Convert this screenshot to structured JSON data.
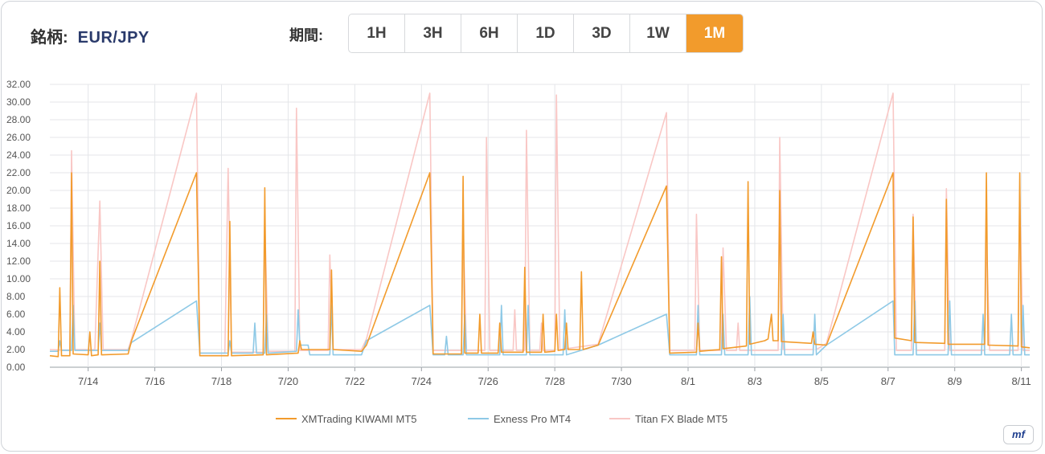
{
  "header": {
    "symbol_label": "銘柄:",
    "symbol_value": "EUR/JPY",
    "period_label": "期間:",
    "periods": [
      "1H",
      "3H",
      "6H",
      "1D",
      "3D",
      "1W",
      "1M"
    ],
    "active_period": "1M"
  },
  "logo_text": "mf",
  "chart_data": {
    "type": "line",
    "title": "",
    "xlabel": "",
    "ylabel": "",
    "ylim": [
      0,
      32
    ],
    "yticks": [
      "0.00",
      "2.00",
      "4.00",
      "6.00",
      "8.00",
      "10.00",
      "12.00",
      "14.00",
      "16.00",
      "18.00",
      "20.00",
      "22.00",
      "24.00",
      "26.00",
      "28.00",
      "30.00",
      "32.00"
    ],
    "xlim": [
      12.85,
      42.25
    ],
    "xticks": [
      {
        "value": 14,
        "label": "7/14"
      },
      {
        "value": 16,
        "label": "7/16"
      },
      {
        "value": 18,
        "label": "7/18"
      },
      {
        "value": 20,
        "label": "7/20"
      },
      {
        "value": 22,
        "label": "7/22"
      },
      {
        "value": 24,
        "label": "7/24"
      },
      {
        "value": 26,
        "label": "7/26"
      },
      {
        "value": 28,
        "label": "7/28"
      },
      {
        "value": 30,
        "label": "7/30"
      },
      {
        "value": 32,
        "label": "8/1"
      },
      {
        "value": 34,
        "label": "8/3"
      },
      {
        "value": 36,
        "label": "8/5"
      },
      {
        "value": 38,
        "label": "8/7"
      },
      {
        "value": 40,
        "label": "8/9"
      },
      {
        "value": 42,
        "label": "8/11"
      }
    ],
    "grid": true,
    "legend_position": "bottom-center",
    "series": [
      {
        "name": "XMTrading KIWAMI MT5",
        "color": "#f29b2c",
        "points": [
          [
            12.85,
            1.3
          ],
          [
            13.1,
            1.2
          ],
          [
            13.15,
            9.0
          ],
          [
            13.2,
            1.3
          ],
          [
            13.45,
            1.3
          ],
          [
            13.5,
            22.0
          ],
          [
            13.55,
            1.5
          ],
          [
            14.0,
            1.4
          ],
          [
            14.05,
            4.0
          ],
          [
            14.1,
            1.3
          ],
          [
            14.3,
            1.4
          ],
          [
            14.35,
            12.0
          ],
          [
            14.4,
            1.4
          ],
          [
            15.2,
            1.5
          ],
          [
            15.3,
            3.0
          ],
          [
            17.25,
            22.0
          ],
          [
            17.35,
            1.3
          ],
          [
            18.2,
            1.3
          ],
          [
            18.25,
            16.5
          ],
          [
            18.3,
            1.3
          ],
          [
            19.25,
            1.4
          ],
          [
            19.3,
            20.3
          ],
          [
            19.35,
            1.4
          ],
          [
            20.3,
            1.6
          ],
          [
            20.35,
            3.0
          ],
          [
            20.4,
            2.0
          ],
          [
            21.25,
            2.0
          ],
          [
            21.3,
            11.0
          ],
          [
            21.35,
            2.0
          ],
          [
            22.2,
            1.8
          ],
          [
            22.35,
            2.5
          ],
          [
            24.25,
            22.0
          ],
          [
            24.35,
            1.5
          ],
          [
            25.2,
            1.5
          ],
          [
            25.25,
            21.6
          ],
          [
            25.3,
            1.6
          ],
          [
            25.7,
            1.6
          ],
          [
            25.75,
            6.0
          ],
          [
            25.8,
            1.6
          ],
          [
            26.3,
            1.6
          ],
          [
            26.35,
            5.0
          ],
          [
            26.4,
            1.7
          ],
          [
            27.05,
            1.7
          ],
          [
            27.1,
            11.3
          ],
          [
            27.15,
            1.7
          ],
          [
            27.6,
            1.7
          ],
          [
            27.65,
            6.0
          ],
          [
            27.7,
            1.7
          ],
          [
            28.0,
            1.8
          ],
          [
            28.05,
            6.0
          ],
          [
            28.1,
            1.9
          ],
          [
            28.3,
            2.0
          ],
          [
            28.35,
            5.0
          ],
          [
            28.4,
            2.0
          ],
          [
            28.75,
            2.0
          ],
          [
            28.8,
            10.8
          ],
          [
            28.85,
            2.0
          ],
          [
            29.3,
            2.5
          ],
          [
            31.35,
            20.5
          ],
          [
            31.45,
            1.6
          ],
          [
            32.25,
            1.7
          ],
          [
            32.3,
            5.0
          ],
          [
            32.35,
            1.8
          ],
          [
            32.95,
            2.0
          ],
          [
            33.0,
            12.5
          ],
          [
            33.05,
            2.1
          ],
          [
            33.75,
            2.4
          ],
          [
            33.8,
            21.0
          ],
          [
            33.85,
            2.6
          ],
          [
            34.3,
            3.0
          ],
          [
            34.4,
            3.2
          ],
          [
            34.5,
            6.0
          ],
          [
            34.55,
            3.0
          ],
          [
            34.7,
            3.0
          ],
          [
            34.75,
            20.0
          ],
          [
            34.8,
            2.9
          ],
          [
            35.7,
            2.7
          ],
          [
            35.75,
            4.0
          ],
          [
            35.8,
            2.6
          ],
          [
            36.15,
            2.5
          ],
          [
            38.15,
            22.0
          ],
          [
            38.2,
            3.3
          ],
          [
            38.7,
            3.0
          ],
          [
            38.75,
            17.0
          ],
          [
            38.8,
            2.8
          ],
          [
            39.7,
            2.7
          ],
          [
            39.75,
            19.0
          ],
          [
            39.8,
            2.6
          ],
          [
            40.9,
            2.6
          ],
          [
            40.95,
            22.0
          ],
          [
            41.0,
            2.5
          ],
          [
            41.9,
            2.4
          ],
          [
            41.95,
            22.0
          ],
          [
            42.0,
            2.3
          ],
          [
            42.25,
            2.2
          ]
        ]
      },
      {
        "name": "Exness Pro MT4",
        "color": "#8ec9e6",
        "points": [
          [
            12.85,
            1.8
          ],
          [
            13.1,
            1.8
          ],
          [
            13.15,
            3.0
          ],
          [
            13.2,
            1.9
          ],
          [
            13.5,
            1.9
          ],
          [
            13.55,
            7.0
          ],
          [
            13.6,
            1.9
          ],
          [
            14.3,
            1.9
          ],
          [
            14.35,
            5.0
          ],
          [
            14.4,
            1.9
          ],
          [
            15.2,
            1.9
          ],
          [
            15.3,
            2.8
          ],
          [
            17.25,
            7.5
          ],
          [
            17.35,
            1.6
          ],
          [
            18.2,
            1.6
          ],
          [
            18.25,
            3.0
          ],
          [
            18.3,
            1.6
          ],
          [
            18.95,
            1.6
          ],
          [
            19.0,
            5.0
          ],
          [
            19.05,
            1.6
          ],
          [
            19.3,
            1.6
          ],
          [
            19.35,
            6.0
          ],
          [
            19.4,
            1.6
          ],
          [
            20.25,
            1.8
          ],
          [
            20.3,
            6.5
          ],
          [
            20.35,
            2.5
          ],
          [
            20.6,
            2.5
          ],
          [
            20.65,
            1.4
          ],
          [
            21.25,
            1.4
          ],
          [
            21.3,
            7.0
          ],
          [
            21.35,
            1.4
          ],
          [
            22.2,
            1.4
          ],
          [
            22.35,
            3.0
          ],
          [
            24.25,
            7.0
          ],
          [
            24.35,
            1.4
          ],
          [
            24.7,
            1.4
          ],
          [
            24.75,
            3.5
          ],
          [
            24.8,
            1.4
          ],
          [
            25.25,
            1.4
          ],
          [
            25.3,
            6.0
          ],
          [
            25.35,
            1.4
          ],
          [
            26.35,
            1.4
          ],
          [
            26.4,
            7.0
          ],
          [
            26.45,
            1.4
          ],
          [
            27.15,
            1.4
          ],
          [
            27.2,
            7.0
          ],
          [
            27.25,
            1.4
          ],
          [
            28.25,
            1.4
          ],
          [
            28.3,
            6.5
          ],
          [
            28.35,
            1.4
          ],
          [
            29.3,
            2.5
          ],
          [
            31.35,
            6.0
          ],
          [
            31.45,
            1.4
          ],
          [
            32.25,
            1.4
          ],
          [
            32.3,
            7.0
          ],
          [
            32.35,
            1.4
          ],
          [
            33.0,
            1.4
          ],
          [
            33.05,
            6.0
          ],
          [
            33.1,
            1.4
          ],
          [
            33.8,
            1.4
          ],
          [
            33.85,
            8.0
          ],
          [
            33.9,
            1.4
          ],
          [
            34.8,
            1.4
          ],
          [
            34.85,
            6.0
          ],
          [
            34.9,
            1.4
          ],
          [
            35.75,
            1.4
          ],
          [
            35.8,
            6.0
          ],
          [
            35.85,
            1.4
          ],
          [
            36.15,
            2.5
          ],
          [
            38.15,
            7.5
          ],
          [
            38.2,
            1.4
          ],
          [
            38.75,
            1.4
          ],
          [
            38.8,
            7.5
          ],
          [
            38.85,
            1.4
          ],
          [
            39.8,
            1.4
          ],
          [
            39.85,
            7.5
          ],
          [
            39.9,
            1.4
          ],
          [
            40.8,
            1.4
          ],
          [
            40.85,
            6.0
          ],
          [
            40.9,
            1.4
          ],
          [
            41.65,
            1.4
          ],
          [
            41.7,
            6.0
          ],
          [
            41.75,
            1.4
          ],
          [
            42.0,
            1.4
          ],
          [
            42.05,
            7.0
          ],
          [
            42.1,
            1.4
          ],
          [
            42.25,
            1.4
          ]
        ]
      },
      {
        "name": "Titan FX Blade MT5",
        "color": "#f9c7c5",
        "points": [
          [
            12.85,
            2.0
          ],
          [
            13.45,
            1.9
          ],
          [
            13.5,
            24.5
          ],
          [
            13.6,
            2.0
          ],
          [
            14.2,
            2.0
          ],
          [
            14.35,
            18.8
          ],
          [
            14.45,
            2.0
          ],
          [
            15.2,
            2.0
          ],
          [
            15.3,
            3.2
          ],
          [
            17.25,
            31.0
          ],
          [
            17.35,
            1.6
          ],
          [
            18.1,
            1.6
          ],
          [
            18.2,
            22.5
          ],
          [
            18.3,
            1.7
          ],
          [
            19.25,
            1.7
          ],
          [
            19.3,
            16.5
          ],
          [
            19.4,
            1.8
          ],
          [
            20.2,
            1.8
          ],
          [
            20.25,
            29.3
          ],
          [
            20.35,
            1.9
          ],
          [
            21.2,
            1.9
          ],
          [
            21.25,
            12.7
          ],
          [
            21.35,
            2.0
          ],
          [
            22.2,
            2.0
          ],
          [
            22.35,
            3.2
          ],
          [
            24.25,
            31.0
          ],
          [
            24.35,
            1.9
          ],
          [
            25.2,
            1.9
          ],
          [
            25.25,
            16.0
          ],
          [
            25.35,
            1.9
          ],
          [
            25.9,
            1.9
          ],
          [
            25.95,
            26.0
          ],
          [
            26.05,
            1.9
          ],
          [
            26.75,
            1.9
          ],
          [
            26.8,
            6.5
          ],
          [
            26.85,
            1.9
          ],
          [
            27.1,
            1.9
          ],
          [
            27.15,
            26.8
          ],
          [
            27.25,
            1.9
          ],
          [
            27.55,
            1.9
          ],
          [
            27.6,
            5.0
          ],
          [
            27.65,
            1.9
          ],
          [
            28.0,
            1.9
          ],
          [
            28.05,
            30.8
          ],
          [
            28.15,
            2.0
          ],
          [
            29.3,
            2.6
          ],
          [
            31.35,
            28.8
          ],
          [
            31.45,
            1.9
          ],
          [
            32.2,
            1.9
          ],
          [
            32.25,
            17.3
          ],
          [
            32.35,
            1.9
          ],
          [
            33.0,
            1.9
          ],
          [
            33.05,
            13.5
          ],
          [
            33.15,
            1.9
          ],
          [
            33.45,
            1.9
          ],
          [
            33.5,
            5.0
          ],
          [
            33.55,
            1.9
          ],
          [
            34.7,
            1.9
          ],
          [
            34.75,
            26.0
          ],
          [
            34.85,
            2.0
          ],
          [
            35.75,
            2.0
          ],
          [
            35.8,
            5.0
          ],
          [
            35.85,
            2.0
          ],
          [
            36.15,
            2.7
          ],
          [
            38.15,
            31.0
          ],
          [
            38.25,
            1.9
          ],
          [
            38.7,
            1.9
          ],
          [
            38.75,
            17.3
          ],
          [
            38.85,
            1.9
          ],
          [
            39.7,
            1.9
          ],
          [
            39.75,
            20.2
          ],
          [
            39.85,
            1.9
          ],
          [
            40.9,
            1.9
          ],
          [
            40.95,
            15.0
          ],
          [
            41.05,
            1.9
          ],
          [
            41.9,
            1.9
          ],
          [
            41.95,
            20.0
          ],
          [
            42.05,
            1.9
          ],
          [
            42.25,
            1.9
          ]
        ]
      }
    ]
  }
}
